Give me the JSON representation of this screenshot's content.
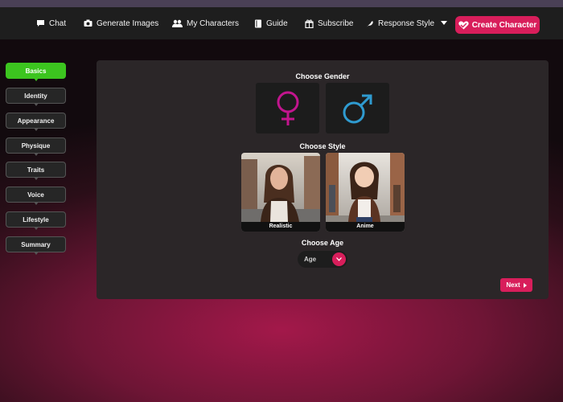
{
  "nav": {
    "chat": "Chat",
    "generate_images": "Generate Images",
    "my_characters": "My Characters",
    "guide": "Guide",
    "subscribe": "Subscribe",
    "response_style": "Response Style",
    "create_character": "Create Character"
  },
  "sidebar": {
    "items": [
      {
        "label": "Basics"
      },
      {
        "label": "Identity"
      },
      {
        "label": "Appearance"
      },
      {
        "label": "Physique"
      },
      {
        "label": "Traits"
      },
      {
        "label": "Voice"
      },
      {
        "label": "Lifestyle"
      },
      {
        "label": "Summary"
      }
    ]
  },
  "main": {
    "gender_title": "Choose Gender",
    "style_title": "Choose Style",
    "styles": [
      {
        "label": "Realistic"
      },
      {
        "label": "Anime"
      }
    ],
    "age_title": "Choose Age",
    "age_placeholder": "Age",
    "next_label": "Next"
  },
  "colors": {
    "accent": "#d81e5b",
    "active_tab": "#3cc51f",
    "female": "#c2158e",
    "male": "#2f9bd0"
  }
}
